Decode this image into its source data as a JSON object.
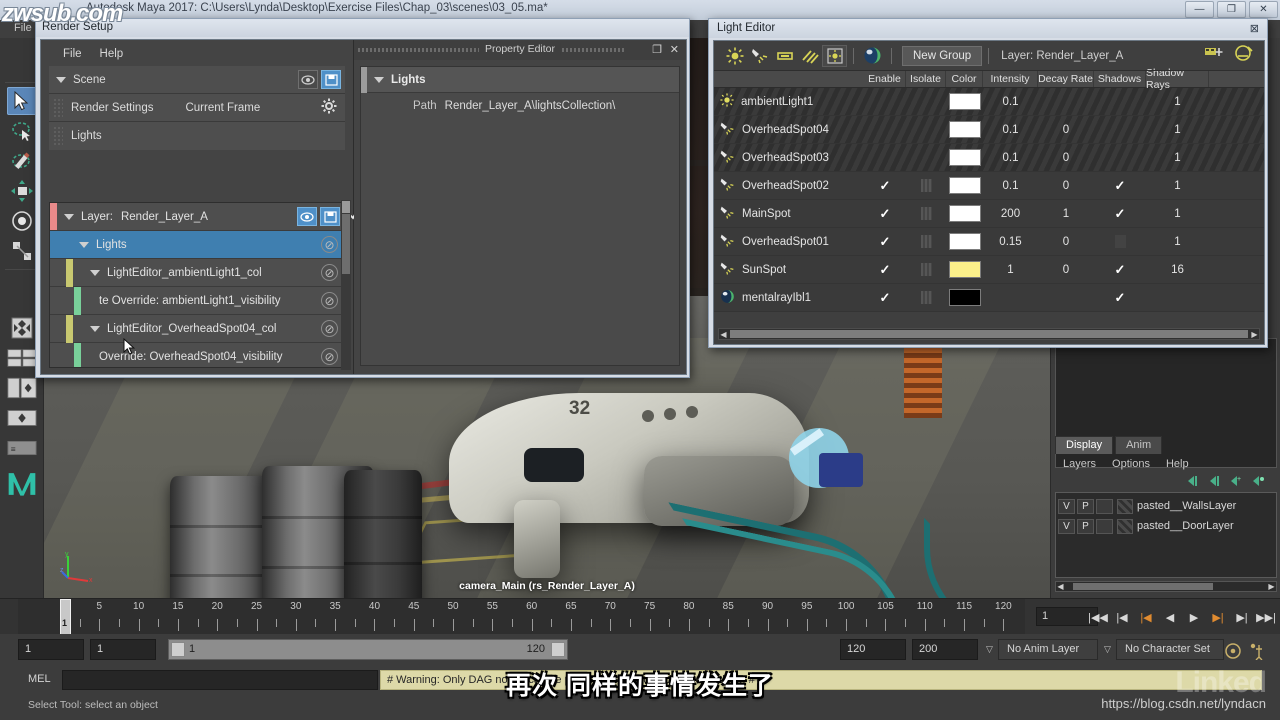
{
  "window": {
    "title_path": "Autodesk Maya 2017: C:\\Users\\Lynda\\Desktop\\Exercise Files\\Chap_03\\scenes\\03_05.ma*",
    "buttons": {
      "minimize": "—",
      "maximize": "❐",
      "close": "✕"
    },
    "watermark_top": "zwsub.com"
  },
  "app_menu": {
    "file": "File",
    "modify": "M",
    "mel_hint": ""
  },
  "render_setup": {
    "title": "Render Setup",
    "menu": {
      "file": "File",
      "help": "Help"
    },
    "scene_row": {
      "label": "Scene"
    },
    "render_settings_row": {
      "label": "Render Settings",
      "value": "Current Frame"
    },
    "lights_row": {
      "label": "Lights"
    },
    "layer_row": {
      "prefix": "Layer:",
      "name": "Render_Layer_A"
    },
    "tree": [
      {
        "label": "Lights",
        "indent": 1,
        "selected": true,
        "bar": "none",
        "caret": true
      },
      {
        "label": "LightEditor_ambientLight1_col",
        "indent": 2,
        "selected": false,
        "bar": "#c8c870",
        "caret": true
      },
      {
        "label": "te Override:   ambientLight1_visibility",
        "indent": 3,
        "selected": false,
        "bar": "#79d09a",
        "caret": false
      },
      {
        "label": "LightEditor_OverheadSpot04_col",
        "indent": 2,
        "selected": false,
        "bar": "#c8c870",
        "caret": true
      },
      {
        "label": "Override:   OverheadSpot04_visibility",
        "indent": 3,
        "selected": false,
        "bar": "#79d09a",
        "caret": false
      }
    ],
    "property_editor": {
      "title": "Property Editor",
      "collection_label": "Lights",
      "path_label": "Path",
      "path_value": "Render_Layer_A\\lightsCollection\\"
    }
  },
  "light_editor": {
    "title": "Light Editor",
    "toolbar": {
      "new_group": "New Group",
      "layer_label": "Layer: Render_Layer_A",
      "icons": [
        "point-light-icon",
        "spot-light-icon",
        "area-light-icon",
        "directional-light-icon",
        "volume-light-icon",
        "image-based-light-icon"
      ],
      "right_icons": [
        "light-linking-icon",
        "light-snapshot-icon"
      ]
    },
    "columns": [
      "",
      "Enable",
      "Isolate",
      "Color",
      "Intensity",
      "Decay Rate",
      "Shadows",
      "Shadow Rays",
      ""
    ],
    "rows": [
      {
        "name": "ambientLight1",
        "icon": "ambient-light-icon",
        "striped": true,
        "enable": false,
        "isolate": false,
        "color": "#ffffff",
        "intensity": "0.1",
        "decay": "",
        "shadows": false,
        "shadow_rays": "1"
      },
      {
        "name": "OverheadSpot04",
        "icon": "spot-light-icon",
        "striped": true,
        "enable": false,
        "isolate": false,
        "color": "#ffffff",
        "intensity": "0.1",
        "decay": "0",
        "shadows": false,
        "shadow_rays": "1"
      },
      {
        "name": "OverheadSpot03",
        "icon": "spot-light-icon",
        "striped": true,
        "enable": false,
        "isolate": false,
        "color": "#ffffff",
        "intensity": "0.1",
        "decay": "0",
        "shadows": false,
        "shadow_rays": "1"
      },
      {
        "name": "OverheadSpot02",
        "icon": "spot-light-icon",
        "striped": false,
        "enable": true,
        "isolate": true,
        "color": "#ffffff",
        "intensity": "0.1",
        "decay": "0",
        "shadows": true,
        "shadow_rays": "1"
      },
      {
        "name": "MainSpot",
        "icon": "spot-light-icon",
        "striped": false,
        "enable": true,
        "isolate": true,
        "color": "#ffffff",
        "intensity": "200",
        "decay": "1",
        "shadows": true,
        "shadow_rays": "1"
      },
      {
        "name": "OverheadSpot01",
        "icon": "spot-light-icon",
        "striped": false,
        "enable": true,
        "isolate": true,
        "color": "#ffffff",
        "intensity": "0.15",
        "decay": "0",
        "shadows": false,
        "shadow_rays": "1"
      },
      {
        "name": "SunSpot",
        "icon": "spot-light-icon",
        "striped": false,
        "enable": true,
        "isolate": true,
        "color": "#fbf08a",
        "intensity": "1",
        "decay": "0",
        "shadows": true,
        "shadow_rays": "16"
      },
      {
        "name": "mentalrayIbl1",
        "icon": "image-based-light-icon",
        "striped": false,
        "enable": true,
        "isolate": true,
        "color": "#000000",
        "intensity": "",
        "decay": "",
        "shadows": true,
        "shadow_rays": ""
      }
    ]
  },
  "viewport": {
    "camera_label": "camera_Main (rs_Render_Layer_A)"
  },
  "layer_editor": {
    "tabs": [
      {
        "label": "Display",
        "active": true
      },
      {
        "label": "Anim",
        "active": false
      }
    ],
    "menu": [
      "Layers",
      "Options",
      "Help"
    ],
    "rows": [
      {
        "v": "V",
        "p": "P",
        "name": "pasted__WallsLayer"
      },
      {
        "v": "V",
        "p": "P",
        "name": "pasted__DoorLayer"
      }
    ]
  },
  "timeline": {
    "ticks": [
      "5",
      "10",
      "15",
      "20",
      "25",
      "30",
      "35",
      "40",
      "45",
      "50",
      "55",
      "60",
      "65",
      "70",
      "75",
      "80",
      "85",
      "90",
      "95",
      "100",
      "105",
      "110",
      "115",
      "120"
    ],
    "current_frame": "1",
    "playhead_label": "1",
    "playback": [
      "go-to-start",
      "step-back-key",
      "step-back-frame",
      "play-backwards",
      "play-forwards",
      "step-forward-frame",
      "step-forward-key",
      "go-to-end"
    ]
  },
  "range": {
    "start_field": "1",
    "anim_start_field": "1",
    "bar_start": "1",
    "bar_end": "120",
    "end_field": "120",
    "anim_end_field": "200",
    "anim_layer": "No Anim Layer",
    "character_set": "No Character Set"
  },
  "command_line": {
    "label": "MEL",
    "input_value": "",
    "warning": "# Warning: Only DAG nodes can be parented or reordered in the Outliner. #"
  },
  "status_bar": {
    "text": "Select Tool: select an object"
  },
  "overlay": {
    "subtitle": "再次 同样的事情发生了",
    "watermark_brand": "Linked",
    "watermark_url": "https://blog.csdn.net/lyndacn"
  },
  "toolbox": {
    "items": [
      "select-tool-icon",
      "lasso-select-icon",
      "paint-select-icon",
      "move-tool-icon",
      "rotate-tool-icon",
      "scale-tool-icon",
      "last-tool-icon",
      "four-view-layout-icon",
      "layout-grid-icon",
      "outliner-layout-icon",
      "hypergraph-layout-icon",
      "persp-layout-icon",
      "maya-logo-icon"
    ]
  },
  "colors": {
    "accent_blue": "#4f90c8",
    "selection_blue": "#3f7fb0",
    "collection_yellow": "#c8c870",
    "override_green": "#79d09a",
    "warning_bg": "#ddd9a8",
    "sun_yellow": "#fbf08a"
  }
}
